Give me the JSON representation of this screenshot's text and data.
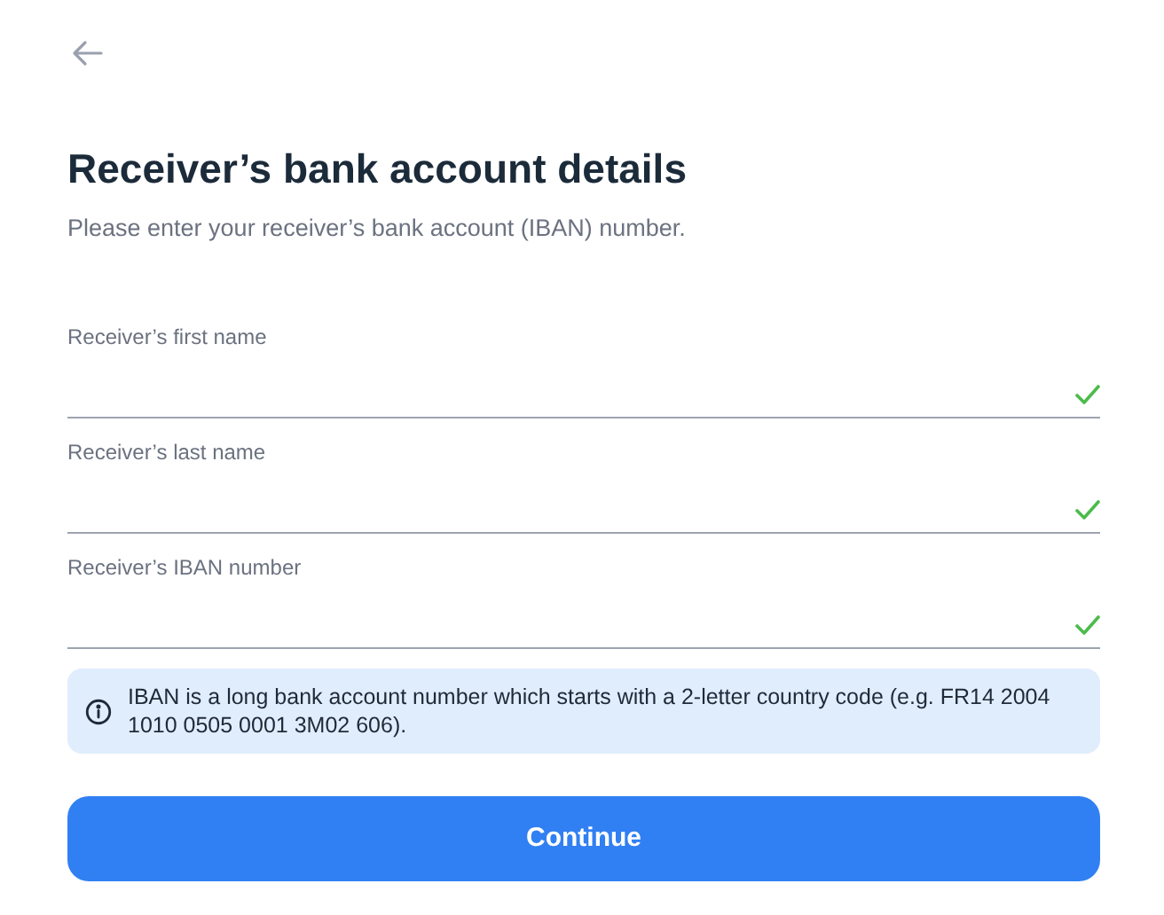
{
  "title": "Receiver’s bank account details",
  "subtitle": "Please enter your receiver’s bank account (IBAN) number.",
  "fields": [
    {
      "label": "Receiver’s first name",
      "valid": true
    },
    {
      "label": "Receiver’s last name",
      "valid": true
    },
    {
      "label": "Receiver’s IBAN number",
      "valid": true
    }
  ],
  "info": "IBAN is a long bank account number which starts with a 2-letter country code (e.g. FR14 2004 1010 0505 0001 3M02 606).",
  "button": "Continue"
}
